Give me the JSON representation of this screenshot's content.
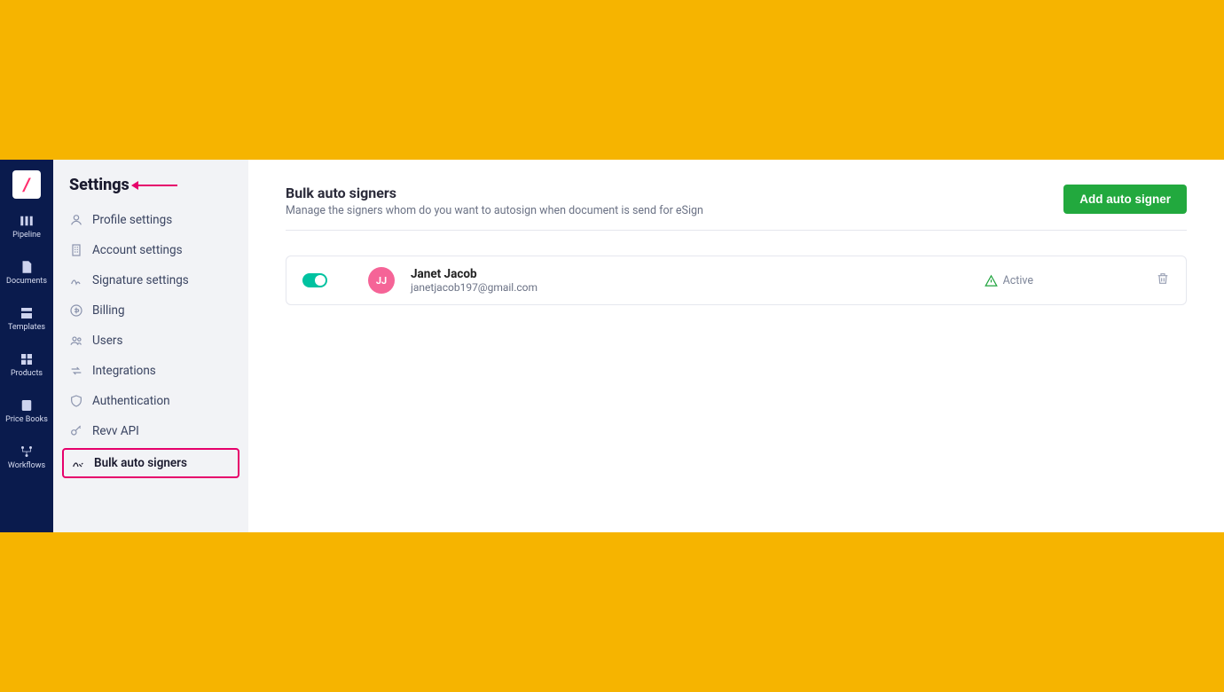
{
  "rail": {
    "items": [
      {
        "label": "Pipeline"
      },
      {
        "label": "Documents"
      },
      {
        "label": "Templates"
      },
      {
        "label": "Products"
      },
      {
        "label": "Price Books"
      },
      {
        "label": "Workflows"
      }
    ]
  },
  "sidebar": {
    "title": "Settings",
    "items": [
      {
        "label": "Profile settings"
      },
      {
        "label": "Account settings"
      },
      {
        "label": "Signature settings"
      },
      {
        "label": "Billing"
      },
      {
        "label": "Users"
      },
      {
        "label": "Integrations"
      },
      {
        "label": "Authentication"
      },
      {
        "label": "Revv API"
      },
      {
        "label": "Bulk auto signers"
      }
    ]
  },
  "main": {
    "heading": "Bulk auto signers",
    "subheading": "Manage the signers whom do you want to autosign when document is send for eSign",
    "add_button": "Add auto signer",
    "signer": {
      "initials": "JJ",
      "name": "Janet Jacob",
      "email": "janetjacob197@gmail.com",
      "status": "Active"
    }
  }
}
